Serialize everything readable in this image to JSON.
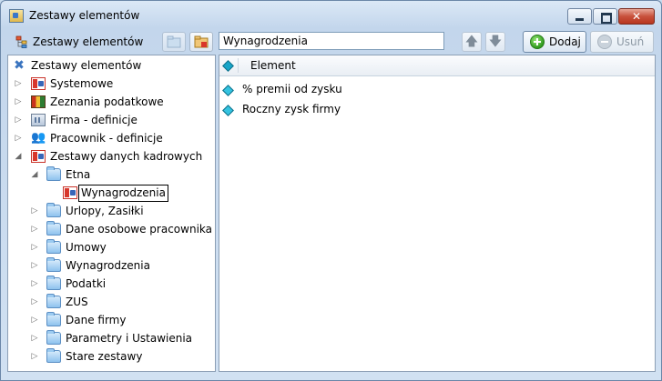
{
  "window": {
    "title": "Zestawy elementów"
  },
  "toolbar": {
    "title": "Zestawy elementów",
    "search_value": "Wynagrodzenia",
    "add_label": "Dodaj",
    "remove_label": "Usuń"
  },
  "tree": {
    "root": "Zestawy elementów",
    "items": [
      "Systemowe",
      "Zeznania podatkowe",
      "Firma - definicje",
      "Pracownik - definicje",
      "Zestawy danych kadrowych"
    ],
    "etna": "Etna",
    "selected": "Wynagrodzenia",
    "folders": [
      "Urlopy, Zasiłki",
      "Dane osobowe pracownika",
      "Umowy",
      "Wynagrodzenia",
      "Podatki",
      "ZUS",
      "Dane firmy",
      "Parametry i Ustawienia",
      "Stare zestawy"
    ]
  },
  "grid": {
    "column_header": "Element",
    "rows": [
      "% premii od zysku",
      "Roczny zysk firmy"
    ]
  },
  "icons": {
    "title": "app-icon",
    "root": "tools-icon",
    "systemowe": "set-icon",
    "zeznania": "books-icon",
    "firma": "building-icon",
    "pracownik": "people-icon",
    "folder": "folder-icon"
  }
}
